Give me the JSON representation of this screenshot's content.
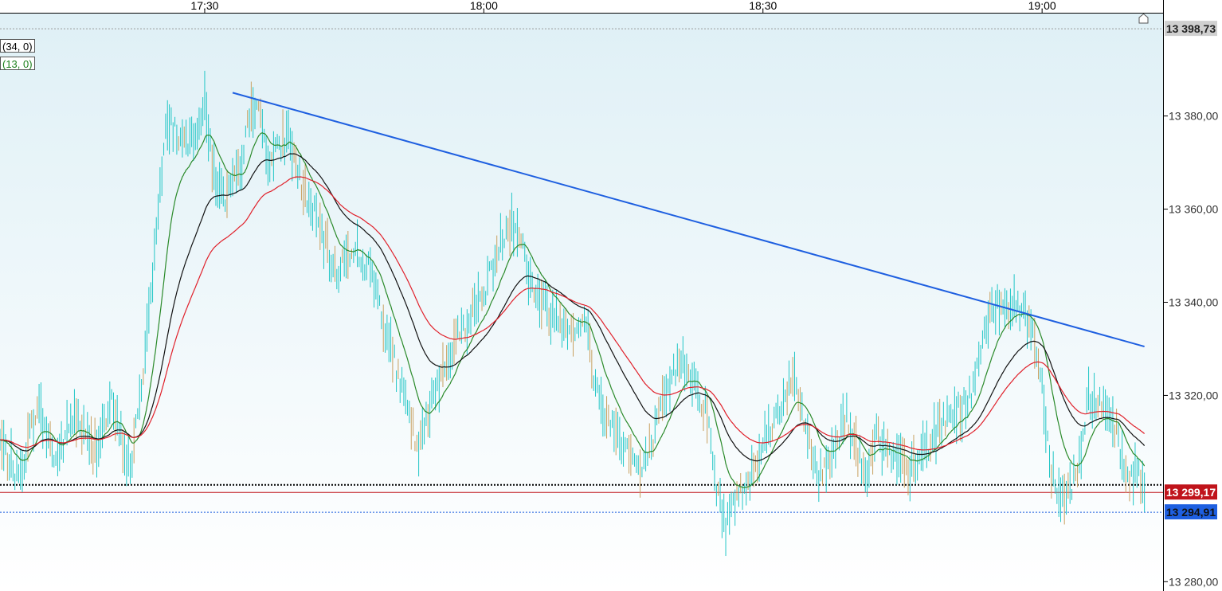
{
  "legend": {
    "ma_slow": "(34, 0)",
    "ma_fast": "(13, 0)"
  },
  "chart_data": {
    "type": "line",
    "x_ticks": [
      "17:30",
      "18:00",
      "18:30",
      "19:00"
    ],
    "y_ticks": [
      "13 380,00",
      "13 360,00",
      "13 340,00",
      "13 320,00",
      "13 280,00"
    ],
    "ylim": [
      13278,
      13402
    ],
    "xlim": [
      "17:08",
      "19:13"
    ],
    "tick_times_min": [
      30,
      60,
      90,
      120
    ],
    "price_points": [
      [
        "17:08",
        13310
      ],
      [
        "17:10",
        13302
      ],
      [
        "17:12",
        13318
      ],
      [
        "17:14",
        13306
      ],
      [
        "17:16",
        13316
      ],
      [
        "17:18",
        13308
      ],
      [
        "17:20",
        13318
      ],
      [
        "17:22",
        13304
      ],
      [
        "17:23",
        13318
      ],
      [
        "17:24",
        13338
      ],
      [
        "17:26",
        13380
      ],
      [
        "17:28",
        13373
      ],
      [
        "17:30",
        13382
      ],
      [
        "17:31",
        13368
      ],
      [
        "17:32",
        13362
      ],
      [
        "17:34",
        13368
      ],
      [
        "17:35",
        13384
      ],
      [
        "17:36",
        13379
      ],
      [
        "17:37",
        13370
      ],
      [
        "17:39",
        13376
      ],
      [
        "17:40",
        13368
      ],
      [
        "17:41",
        13362
      ],
      [
        "17:42",
        13358
      ],
      [
        "17:44",
        13346
      ],
      [
        "17:46",
        13352
      ],
      [
        "17:48",
        13346
      ],
      [
        "17:50",
        13330
      ],
      [
        "17:52",
        13315
      ],
      [
        "17:53",
        13308
      ],
      [
        "17:55",
        13323
      ],
      [
        "17:57",
        13332
      ],
      [
        "18:00",
        13342
      ],
      [
        "18:02",
        13354
      ],
      [
        "18:03",
        13358
      ],
      [
        "18:04",
        13354
      ],
      [
        "18:05",
        13344
      ],
      [
        "18:07",
        13338
      ],
      [
        "18:09",
        13335
      ],
      [
        "18:11",
        13335
      ],
      [
        "18:12",
        13322
      ],
      [
        "18:13",
        13316
      ],
      [
        "18:15",
        13310
      ],
      [
        "18:17",
        13303
      ],
      [
        "18:19",
        13316
      ],
      [
        "18:21",
        13328
      ],
      [
        "18:22",
        13326
      ],
      [
        "18:24",
        13316
      ],
      [
        "18:25",
        13300
      ],
      [
        "18:26",
        13292
      ],
      [
        "18:27",
        13298
      ],
      [
        "18:28",
        13300
      ],
      [
        "18:30",
        13310
      ],
      [
        "18:32",
        13318
      ],
      [
        "18:33",
        13324
      ],
      [
        "18:34",
        13318
      ],
      [
        "18:36",
        13302
      ],
      [
        "18:37",
        13306
      ],
      [
        "18:39",
        13316
      ],
      [
        "18:41",
        13302
      ],
      [
        "18:42",
        13312
      ],
      [
        "18:44",
        13306
      ],
      [
        "18:46",
        13304
      ],
      [
        "18:48",
        13310
      ],
      [
        "18:50",
        13316
      ],
      [
        "18:52",
        13318
      ],
      [
        "18:54",
        13334
      ],
      [
        "18:55",
        13340
      ],
      [
        "18:56",
        13340
      ],
      [
        "18:58",
        13338
      ],
      [
        "18:59",
        13334
      ],
      [
        "19:00",
        13322
      ],
      [
        "19:01",
        13304
      ],
      [
        "19:02",
        13298
      ],
      [
        "19:03",
        13300
      ],
      [
        "19:04",
        13306
      ],
      [
        "19:05",
        13320
      ],
      [
        "19:06",
        13318
      ],
      [
        "19:08",
        13312
      ],
      [
        "19:09",
        13302
      ],
      [
        "19:10",
        13304
      ],
      [
        "19:11",
        13300
      ]
    ],
    "series": [
      {
        "values_from": "price_points",
        "color": "#22c6c6"
      },
      {
        "values_from": "price_points",
        "smoothing": 13,
        "color": "#2a8a2a"
      },
      {
        "values_from": "price_points",
        "smoothing": 34,
        "color": "#111111"
      },
      {
        "values_from": "price_points",
        "smoothing": 55,
        "color": "#e0202a"
      }
    ],
    "trendline": {
      "color": "#1e5fe0",
      "points": [
        [
          "17:33",
          13385
        ],
        [
          "19:11",
          13330.5
        ]
      ]
    },
    "horizontal_lines": [
      {
        "value": 13300.8,
        "color": "#000000",
        "style": "dotted"
      },
      {
        "value": 13299.17,
        "color": "#c0141b",
        "style": "solid"
      },
      {
        "value": 13294.91,
        "color": "#1e5fe0",
        "style": "dotted"
      },
      {
        "value": 13398.73,
        "color": "#999999",
        "style": "dotted"
      }
    ],
    "price_tags": [
      {
        "label": "13 398,73",
        "value": 13398.73,
        "bg": "#d0d0d0",
        "fg": "#222222"
      },
      {
        "label": "13 299,17",
        "value": 13299.17,
        "bg": "#c0141b",
        "fg": "#ffffff"
      },
      {
        "label": "13 294,91",
        "value": 13294.91,
        "bg": "#1e5fe0",
        "fg": "#111111"
      }
    ],
    "background": {
      "top": "#dff0f6",
      "bottom": "#ffffff"
    },
    "grid": false
  }
}
